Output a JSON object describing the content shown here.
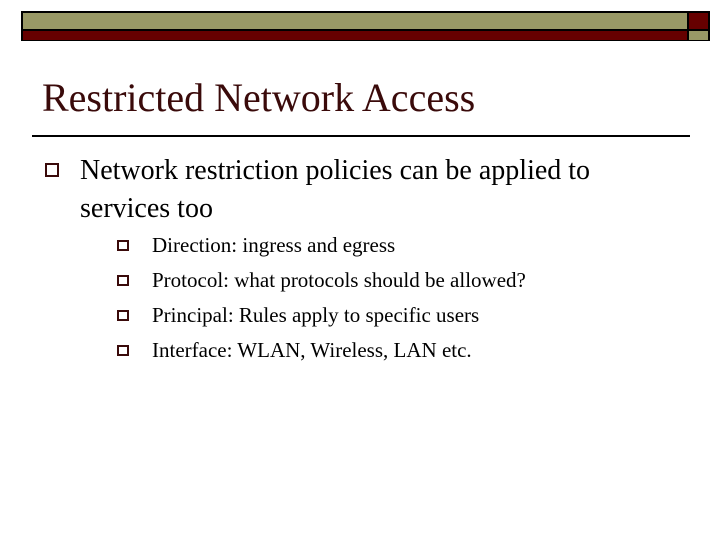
{
  "header": {
    "colors": {
      "olive": "#999966",
      "maroon": "#660000",
      "border": "#000000"
    }
  },
  "slide": {
    "title": "Restricted Network Access",
    "title_color": "#3a0a0a",
    "bullets": [
      {
        "text": "Network restriction policies can be applied to services too",
        "sub_bullets": [
          {
            "text": "Direction: ingress and egress"
          },
          {
            "text": "Protocol: what protocols should be allowed?"
          },
          {
            "text": "Principal: Rules apply to specific users"
          },
          {
            "text": "Interface: WLAN, Wireless, LAN etc."
          }
        ]
      }
    ],
    "bullet_icon": "hollow-square"
  }
}
